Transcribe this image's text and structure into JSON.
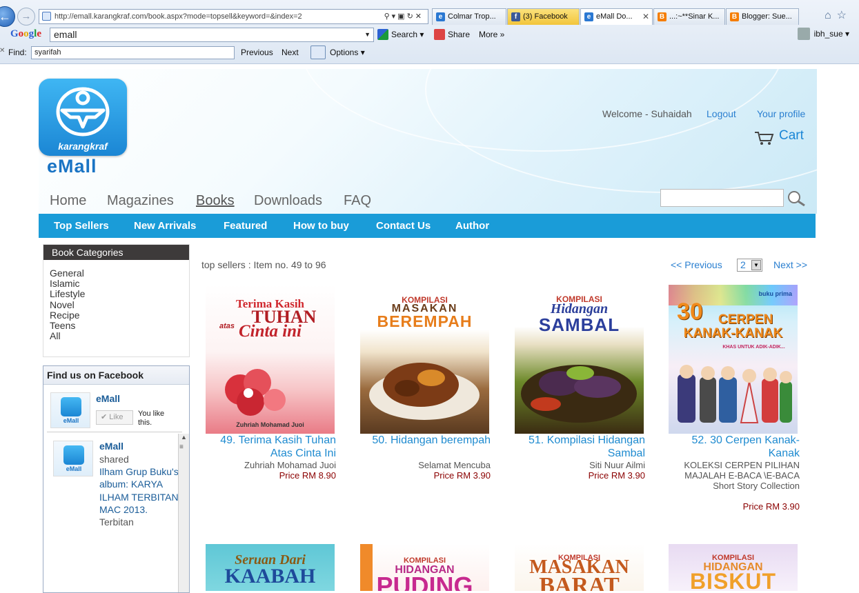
{
  "browser": {
    "url": "http://emall.karangkraf.com/book.aspx?mode=topsell&keyword=&index=2",
    "tabs": [
      {
        "label": "Colmar Trop...",
        "icon": "e"
      },
      {
        "label": "(3) Facebook",
        "icon": "f"
      },
      {
        "label": "eMall Do...",
        "icon": "e"
      },
      {
        "label": "...:~**Sinar K...",
        "icon": "B"
      },
      {
        "label": "Blogger: Sue...",
        "icon": "B"
      }
    ],
    "google": {
      "logo": "Google",
      "query": "emall",
      "search_label": "Search",
      "share_label": "Share",
      "more_label": "More »",
      "user": "ibh_sue"
    },
    "find": {
      "label": "Find:",
      "value": "syarifah",
      "previous": "Previous",
      "next": "Next",
      "options": "Options"
    }
  },
  "site": {
    "logo_text": "karangkraf",
    "brand": "eMall",
    "welcome": "Welcome - Suhaidah",
    "logout": "Logout",
    "profile": "Your profile",
    "cart": "Cart",
    "main_nav": [
      "Home",
      "Magazines",
      "Books",
      "Downloads",
      "FAQ"
    ],
    "sub_nav": [
      "Top Sellers",
      "New Arrivals",
      "Featured",
      "How to buy",
      "Contact Us",
      "Author"
    ],
    "categories_title": "Book Categories",
    "categories": [
      "General",
      "Islamic",
      "Lifestyle",
      "Novel",
      "Recipe",
      "Teens",
      "All"
    ],
    "facebook": {
      "title": "Find us on Facebook",
      "page_name": "eMall",
      "like_label": "Like",
      "you_like": "You like this.",
      "feed_name": "eMall",
      "feed_text": "shared",
      "feed_link": "Ilham Grup Buku's album: KARYA ILHAM TERBITAN MAC 2013.",
      "feed_more": "Terbitan"
    },
    "listing": {
      "summary": "top sellers : Item no. 49 to 96",
      "prev": "<< Previous",
      "page": "2",
      "next": "Next >>"
    },
    "books": [
      {
        "title": "49. Terima Kasih Tuhan Atas Cinta Ini",
        "author": "Zuhriah Mohamad Juoi",
        "price": "Price RM 8.90"
      },
      {
        "title": "50. Hidangan berempah",
        "author": "Selamat Mencuba",
        "price": "Price RM 3.90"
      },
      {
        "title": "51. Kompilasi Hidangan Sambal",
        "author": "Siti Nuur Ailmi",
        "price": "Price RM 3.90"
      },
      {
        "title": "52. 30 Cerpen Kanak-Kanak",
        "author": "KOLEKSI CERPEN PILIHAN MAJALAH E-BACA \\E-BACA Short Story Collection",
        "price": "Price RM 3.90"
      }
    ],
    "covers": {
      "c1": {
        "l1": "Terima Kasih",
        "l2": "TUHAN",
        "l3": "Cinta ini",
        "l4": "atas",
        "foot": "Zuhriah Mohamad Juoi"
      },
      "c2": {
        "l1": "KOMPILASI",
        "l2": "MASAKAN",
        "l3": "BEREMPAH"
      },
      "c3": {
        "l1": "KOMPILASI",
        "l2": "Hidangan",
        "l3": "SAMBAL"
      },
      "c4": {
        "l1": "30",
        "l2": "CERPEN",
        "l3": "KANAK-KANAK",
        "l4": "KHAS UNTUK ADIK-ADIK...",
        "l5": "buku prima"
      },
      "c5": {
        "l1": "Seruan Dari",
        "l2": "KAABAH"
      },
      "c6": {
        "l1": "KOMPILASI",
        "l2": "HIDANGAN",
        "l3": "PUDING"
      },
      "c7": {
        "l1": "KOMPILASI",
        "l2": "MASAKAN",
        "l3": "BARAT"
      },
      "c8": {
        "l1": "KOMPILASI",
        "l2": "HIDANGAN",
        "l3": "BISKUT"
      }
    }
  }
}
